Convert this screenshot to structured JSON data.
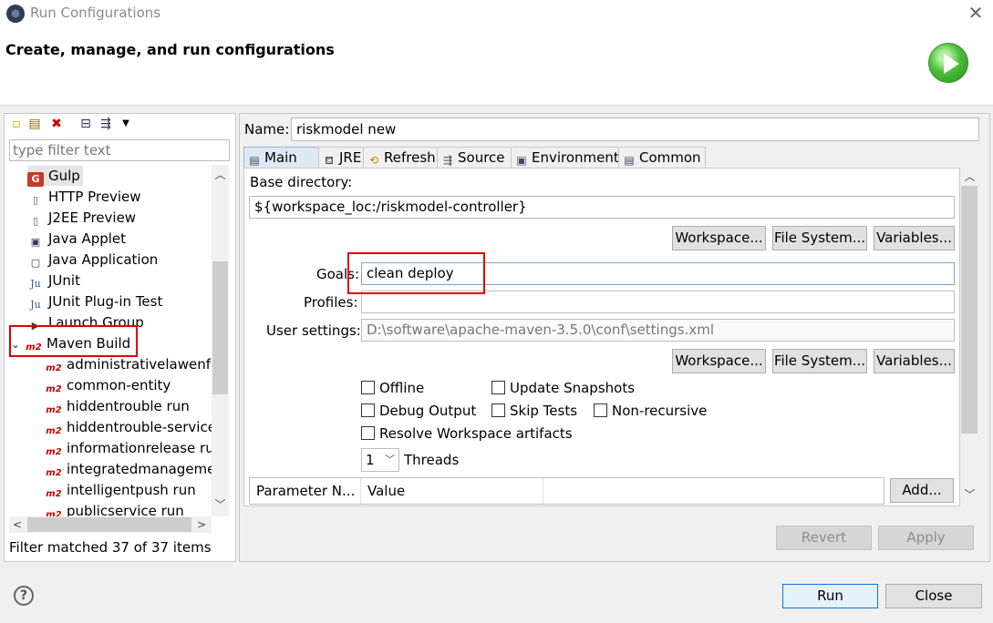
{
  "window": {
    "title": "Run Configurations",
    "close_glyph": "✕"
  },
  "header": {
    "title": "Create, manage, and run configurations"
  },
  "left": {
    "filter_placeholder": "type filter text",
    "items": [
      {
        "label": "Gulp",
        "icon": "gulp-icon",
        "glyph": "G"
      },
      {
        "label": "HTTP Preview",
        "icon": "http-preview-icon",
        "glyph": "▯"
      },
      {
        "label": "J2EE Preview",
        "icon": "j2ee-preview-icon",
        "glyph": "▯"
      },
      {
        "label": "Java Applet",
        "icon": "java-applet-icon",
        "glyph": "▣"
      },
      {
        "label": "Java Application",
        "icon": "java-application-icon",
        "glyph": "▢"
      },
      {
        "label": "JUnit",
        "icon": "junit-icon",
        "glyph": "Ju"
      },
      {
        "label": "JUnit Plug-in Test",
        "icon": "junit-plugin-icon",
        "glyph": "Ju"
      },
      {
        "label": "Launch Group",
        "icon": "launch-group-icon",
        "glyph": "▶"
      },
      {
        "label": "Maven Build",
        "icon": "maven-icon",
        "glyph": "m2"
      },
      {
        "label": "administrativelawenfo",
        "icon": "maven-icon",
        "glyph": "m2"
      },
      {
        "label": "common-entity",
        "icon": "maven-icon",
        "glyph": "m2"
      },
      {
        "label": "hiddentrouble run",
        "icon": "maven-icon",
        "glyph": "m2"
      },
      {
        "label": "hiddentrouble-service",
        "icon": "maven-icon",
        "glyph": "m2"
      },
      {
        "label": "informationrelease rur",
        "icon": "maven-icon",
        "glyph": "m2"
      },
      {
        "label": "integratedmanageme",
        "icon": "maven-icon",
        "glyph": "m2"
      },
      {
        "label": "intelligentpush run",
        "icon": "maven-icon",
        "glyph": "m2"
      },
      {
        "label": "publicservice run",
        "icon": "maven-icon",
        "glyph": "m2"
      }
    ],
    "expand_glyph": "⌄",
    "status": "Filter matched 37 of 37 items",
    "arrows": {
      "up": "︿",
      "down": "﹀",
      "left": "<",
      "right": ">"
    }
  },
  "main": {
    "name_label": "Name:",
    "name_value": "riskmodel  new",
    "tabs": [
      {
        "label": "Main",
        "icon": "main-tab-icon",
        "glyph": "▤"
      },
      {
        "label": "JRE",
        "icon": "jre-tab-icon",
        "glyph": "⛾"
      },
      {
        "label": "Refresh",
        "icon": "refresh-tab-icon",
        "glyph": "⟲"
      },
      {
        "label": "Source",
        "icon": "source-tab-icon",
        "glyph": "⇶"
      },
      {
        "label": "Environment",
        "icon": "environment-tab-icon",
        "glyph": "▣"
      },
      {
        "label": "Common",
        "icon": "common-tab-icon",
        "glyph": "▤"
      }
    ],
    "base_dir_label": "Base directory:",
    "base_dir_value": "${workspace_loc:/riskmodel-controller}",
    "workspace_btn": "Workspace...",
    "filesystem_btn": "File System...",
    "variables_btn": "Variables...",
    "goals_label": "Goals:",
    "goals_value": "clean deploy",
    "profiles_label": "Profiles:",
    "profiles_value": "",
    "user_settings_label": "User settings:",
    "user_settings_value": "D:\\software\\apache-maven-3.5.0\\conf\\settings.xml",
    "checks": {
      "offline": "Offline",
      "update_snapshots": "Update Snapshots",
      "debug_output": "Debug Output",
      "skip_tests": "Skip Tests",
      "non_recursive": "Non-recursive",
      "resolve_workspace": "Resolve Workspace artifacts"
    },
    "threads_value": "1",
    "threads_label": "Threads",
    "param_headers": [
      "Parameter N...",
      "Value"
    ],
    "add_btn": "Add...",
    "revert_btn": "Revert",
    "apply_btn": "Apply"
  },
  "footer": {
    "help_glyph": "?",
    "run_btn": "Run",
    "close_btn": "Close"
  },
  "colors": {
    "highlight_red": "#e00000",
    "run_green": "#4bbf3b"
  }
}
